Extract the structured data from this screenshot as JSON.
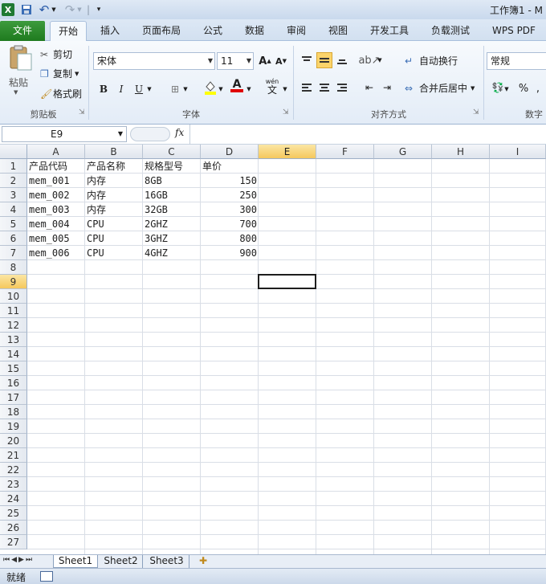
{
  "window": {
    "title": "工作簿1 - M"
  },
  "tabs": {
    "file": "文件",
    "home": "开始",
    "insert": "插入",
    "page_layout": "页面布局",
    "formulas": "公式",
    "data": "数据",
    "review": "审阅",
    "view": "视图",
    "developer": "开发工具",
    "load_test": "负载测试",
    "wps_pdf": "WPS PDF"
  },
  "ribbon": {
    "clipboard": {
      "paste": "粘贴",
      "cut": "剪切",
      "copy": "复制",
      "format_painter": "格式刷",
      "label": "剪贴板"
    },
    "font": {
      "name": "宋体",
      "size": "11",
      "bold": "B",
      "italic": "I",
      "underline": "U",
      "font_color": "A",
      "phonetic": "wén",
      "label": "字体"
    },
    "alignment": {
      "wrap_text": "自动换行",
      "merge_center": "合并后居中",
      "label": "对齐方式"
    },
    "number": {
      "format": "常规",
      "percent": "%",
      "label": "数字"
    }
  },
  "formula_bar": {
    "name_box": "E9",
    "fx": "fx",
    "value": ""
  },
  "columns": [
    "A",
    "B",
    "C",
    "D",
    "E",
    "F",
    "G",
    "H",
    "I"
  ],
  "rows": [
    "1",
    "2",
    "3",
    "4",
    "5",
    "6",
    "7",
    "8",
    "9",
    "10",
    "11",
    "12",
    "13",
    "14",
    "15",
    "16",
    "17",
    "18",
    "19",
    "20",
    "21",
    "22",
    "23",
    "24",
    "25",
    "26",
    "27"
  ],
  "selected": {
    "column": "E",
    "row": "9"
  },
  "table": {
    "headers": [
      "产品代码",
      "产品名称",
      "规格型号",
      "单价"
    ],
    "rows": [
      [
        "mem_001",
        "内存",
        "8GB",
        "150"
      ],
      [
        "mem_002",
        "内存",
        "16GB",
        "250"
      ],
      [
        "mem_003",
        "内存",
        "32GB",
        "300"
      ],
      [
        "mem_004",
        "CPU",
        "2GHZ",
        "700"
      ],
      [
        "mem_005",
        "CPU",
        "3GHZ",
        "800"
      ],
      [
        "mem_006",
        "CPU",
        "4GHZ",
        "900"
      ]
    ]
  },
  "sheets": [
    "Sheet1",
    "Sheet2",
    "Sheet3"
  ],
  "status": {
    "ready": "就绪"
  },
  "colors": {
    "file_tab": "#2a8a2a",
    "selection_header": "#f5c85d",
    "ribbon_bg": "#e3ecf7"
  }
}
